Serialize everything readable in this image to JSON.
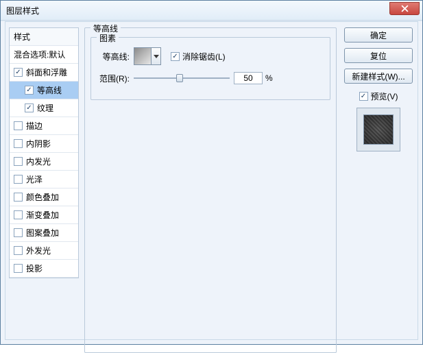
{
  "window_title": "图层样式",
  "styles_panel": {
    "header": "样式",
    "blend_options": "混合选项:默认",
    "items": [
      {
        "label": "斜面和浮雕",
        "checked": true,
        "selected": false,
        "indent": false
      },
      {
        "label": "等高线",
        "checked": true,
        "selected": true,
        "indent": true
      },
      {
        "label": "纹理",
        "checked": true,
        "selected": false,
        "indent": true
      },
      {
        "label": "描边",
        "checked": false,
        "selected": false,
        "indent": false
      },
      {
        "label": "内阴影",
        "checked": false,
        "selected": false,
        "indent": false
      },
      {
        "label": "内发光",
        "checked": false,
        "selected": false,
        "indent": false
      },
      {
        "label": "光泽",
        "checked": false,
        "selected": false,
        "indent": false
      },
      {
        "label": "颜色叠加",
        "checked": false,
        "selected": false,
        "indent": false
      },
      {
        "label": "渐变叠加",
        "checked": false,
        "selected": false,
        "indent": false
      },
      {
        "label": "图案叠加",
        "checked": false,
        "selected": false,
        "indent": false
      },
      {
        "label": "外发光",
        "checked": false,
        "selected": false,
        "indent": false
      },
      {
        "label": "投影",
        "checked": false,
        "selected": false,
        "indent": false
      }
    ]
  },
  "main": {
    "group_title": "等高线",
    "element_group": "图素",
    "contour_label": "等高线:",
    "antialias_label": "消除锯齿(L)",
    "range_label": "范围(R):",
    "range_value": "50",
    "range_unit": "%"
  },
  "buttons": {
    "ok": "确定",
    "reset": "复位",
    "new_style": "新建样式(W)...",
    "preview": "预览(V)"
  }
}
